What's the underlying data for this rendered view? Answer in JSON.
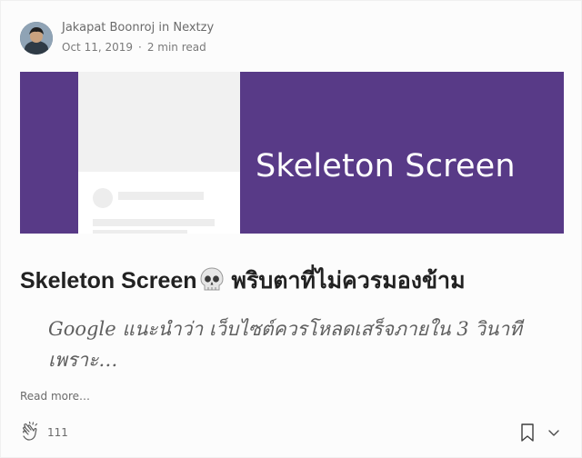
{
  "author": {
    "name": "Jakapat Boonroj",
    "in_word": "in",
    "publication": "Nextzy",
    "date": "Oct 11, 2019",
    "separator": "·",
    "read_time": "2 min read"
  },
  "hero": {
    "title": "Skeleton Screen",
    "background_color": "#583a87"
  },
  "post": {
    "title_prefix": "Skeleton Screen",
    "title_emoji": "skull-icon",
    "title_suffix": " พริบตาที่ไม่ควรมองข้าม",
    "subtitle": "Google แนะนำว่า เว็บไซต์ควรโหลดเสร็จภายใน 3 วินาที เพราะ…",
    "read_more": "Read more…"
  },
  "footer": {
    "claps": "111",
    "clap_icon": "clap-icon",
    "bookmark_icon": "bookmark-icon",
    "more_icon": "chevron-down-icon"
  }
}
